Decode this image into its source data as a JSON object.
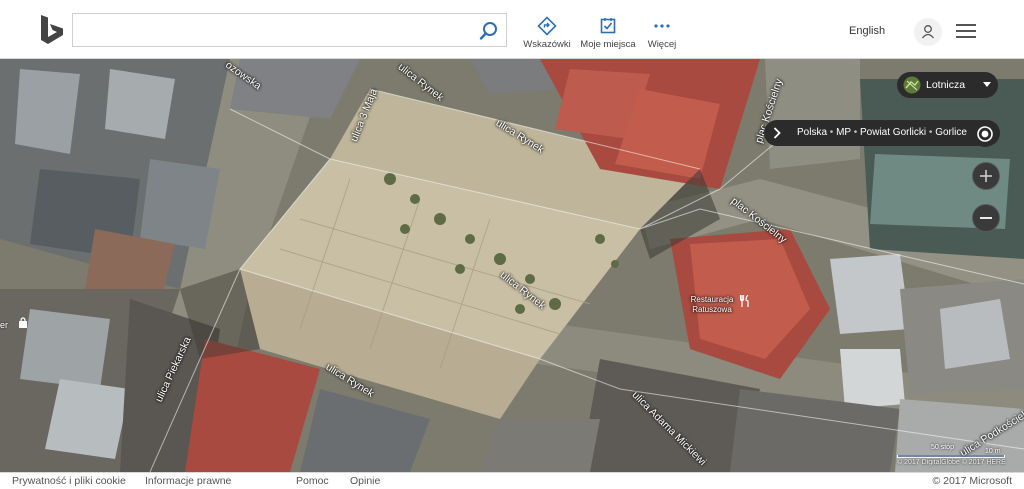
{
  "search": {
    "value": "",
    "placeholder": ""
  },
  "toolbar": {
    "directions_label": "Wskazówki",
    "my_places_label": "Moje miejsca",
    "more_label": "Więcej",
    "language_label": "English"
  },
  "map_controls": {
    "layer_label": "Lotnicza",
    "breadcrumb": [
      "Polska",
      "MP",
      "Powiat Gorlicki",
      "Gorlice"
    ],
    "breadcrumb_separator": "•",
    "scale_feet": "50 stóp",
    "scale_meters": "10 m",
    "imagery_copyright": "© 2017 DigitalGlobe © 2017 HERE"
  },
  "map_labels": {
    "streets": [
      {
        "id": "rynek-top",
        "text": "ulica Rynek"
      },
      {
        "id": "rynek-mid",
        "text": "ulica Rynek"
      },
      {
        "id": "rynek-center",
        "text": "ulica Rynek"
      },
      {
        "id": "rynek-bottom",
        "text": "ulica Rynek"
      },
      {
        "id": "3-maja",
        "text": "ulica 3 Maja"
      },
      {
        "id": "kosciuszki",
        "text": "ozowska"
      },
      {
        "id": "plac-koscielny-top",
        "text": "plac Kościelny"
      },
      {
        "id": "plac-koscielny-mid",
        "text": "plac Kościelny"
      },
      {
        "id": "piekarska",
        "text": "ulica Piekarska"
      },
      {
        "id": "mickiewicza",
        "text": "ulica Adama Mickiewi"
      },
      {
        "id": "podkosciele",
        "text": "ulica Podkościele"
      }
    ],
    "poi_name": "Restauracja Ratuszowa",
    "left_edge_text": "er"
  },
  "footer": {
    "privacy_label": "Prywatność i pliki cookie",
    "legal_label": "Informacje prawne",
    "help_label": "Pomoc",
    "feedback_label": "Opinie",
    "copyright": "© 2017 Microsoft"
  },
  "colors": {
    "brand": "#008373",
    "control_bg": "#2b2b2b",
    "roof_red": "#a84a3f"
  }
}
